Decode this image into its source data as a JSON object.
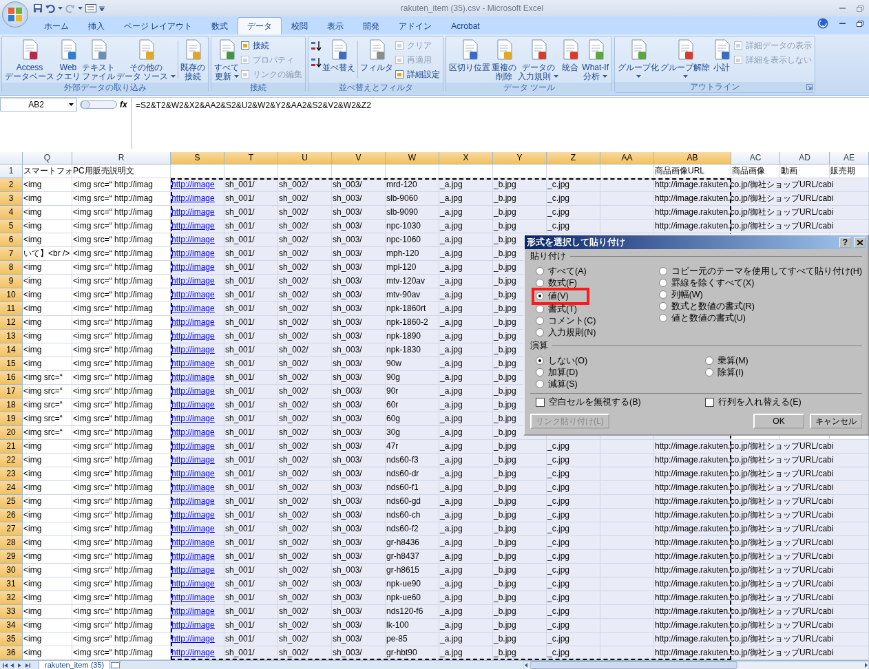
{
  "window": {
    "title": "rakuten_item (35).csv - Microsoft Excel"
  },
  "tabs": [
    {
      "label": "ホーム",
      "selected": false
    },
    {
      "label": "挿入",
      "selected": false
    },
    {
      "label": "ページ レイアウト",
      "selected": false
    },
    {
      "label": "数式",
      "selected": false
    },
    {
      "label": "データ",
      "selected": true
    },
    {
      "label": "校閲",
      "selected": false
    },
    {
      "label": "表示",
      "selected": false
    },
    {
      "label": "開発",
      "selected": false
    },
    {
      "label": "アドイン",
      "selected": false
    },
    {
      "label": "Acrobat",
      "selected": false
    }
  ],
  "ribbon": {
    "groups": [
      {
        "label": "外部データの取り込み",
        "launcher": false,
        "items": [
          {
            "kind": "large",
            "lines": [
              "Access",
              "データベース"
            ],
            "dropdown": false
          },
          {
            "kind": "large",
            "lines": [
              "Web",
              "クエリ"
            ],
            "dropdown": false
          },
          {
            "kind": "large",
            "lines": [
              "テキスト",
              "ファイル"
            ],
            "dropdown": false
          },
          {
            "kind": "large",
            "lines": [
              "その他の",
              "データ ソース"
            ],
            "dropdown": true
          },
          {
            "kind": "separator"
          },
          {
            "kind": "large",
            "lines": [
              "既存の",
              "接続"
            ],
            "dropdown": false
          }
        ]
      },
      {
        "label": "接続",
        "launcher": false,
        "items": [
          {
            "kind": "large",
            "lines": [
              "すべて",
              "更新"
            ],
            "dropdown": true
          },
          {
            "kind": "stack",
            "items": [
              {
                "label": "接続",
                "disabled": false
              },
              {
                "label": "プロパティ",
                "disabled": true
              },
              {
                "label": "リンクの編集",
                "disabled": true
              }
            ]
          }
        ]
      },
      {
        "label": "並べ替えとフィルタ",
        "launcher": false,
        "items": [
          {
            "kind": "stack",
            "items": [
              {
                "disabled": false
              },
              {
                "disabled": false
              }
            ]
          },
          {
            "kind": "large",
            "lines": [
              "並べ替え"
            ],
            "dropdown": false
          },
          {
            "kind": "separator"
          },
          {
            "kind": "large",
            "lines": [
              "フィルタ"
            ],
            "dropdown": false
          },
          {
            "kind": "stack",
            "items": [
              {
                "label": "クリア",
                "disabled": true
              },
              {
                "label": "再適用",
                "disabled": true
              },
              {
                "label": "詳細設定",
                "disabled": false
              }
            ]
          }
        ]
      },
      {
        "label": "データ ツール",
        "launcher": false,
        "items": [
          {
            "kind": "large",
            "lines": [
              "区切り位置"
            ],
            "dropdown": false
          },
          {
            "kind": "large",
            "lines": [
              "重複の",
              "削除"
            ],
            "dropdown": false
          },
          {
            "kind": "large",
            "lines": [
              "データの",
              "入力規則"
            ],
            "dropdown": true
          },
          {
            "kind": "large",
            "lines": [
              "統合"
            ],
            "dropdown": false
          },
          {
            "kind": "large",
            "lines": [
              "What-If",
              "分析"
            ],
            "dropdown": true
          }
        ]
      },
      {
        "label": "アウトライン",
        "launcher": true,
        "items": [
          {
            "kind": "large",
            "lines": [
              "グループ化"
            ],
            "dropdown": true
          },
          {
            "kind": "large",
            "lines": [
              "グループ解除"
            ],
            "dropdown": true
          },
          {
            "kind": "large",
            "lines": [
              "小計"
            ],
            "dropdown": false
          },
          {
            "kind": "stack",
            "items": [
              {
                "label": "詳細データの表示",
                "disabled": true
              },
              {
                "label": "詳細を表示しない",
                "disabled": true
              }
            ]
          }
        ]
      }
    ]
  },
  "formula_bar": {
    "name_box": "AB2",
    "fx_label": "fx",
    "formula": "=S2&T2&W2&X2&AA2&S2&U2&W2&Y2&AA2&S2&V2&W2&Z2"
  },
  "columns": [
    {
      "label": "Q",
      "selected": false,
      "kind": "text"
    },
    {
      "label": "R",
      "selected": false,
      "kind": "text"
    },
    {
      "label": "S",
      "selected": true,
      "kind": "link"
    },
    {
      "label": "T",
      "selected": true,
      "kind": "text"
    },
    {
      "label": "U",
      "selected": true,
      "kind": "text"
    },
    {
      "label": "V",
      "selected": true,
      "kind": "text"
    },
    {
      "label": "W",
      "selected": true,
      "kind": "text"
    },
    {
      "label": "X",
      "selected": true,
      "kind": "text"
    },
    {
      "label": "Y",
      "selected": true,
      "kind": "text"
    },
    {
      "label": "Z",
      "selected": true,
      "kind": "text"
    },
    {
      "label": "AA",
      "selected": true
    },
    {
      "label": "AB",
      "selected": true,
      "kind": "text"
    },
    {
      "label": "AC",
      "selected": false,
      "kind": "text"
    },
    {
      "label": "AD",
      "selected": false,
      "kind": "text"
    },
    {
      "label": "AE",
      "selected": false,
      "kind": "text"
    }
  ],
  "rows": [
    {
      "number": "1",
      "selected": false,
      "cells": [
        "スマートフォ",
        "PC用販売説明文",
        null,
        null,
        null,
        null,
        null,
        null,
        null,
        null,
        null,
        "商品画像URL",
        "商品画像",
        "動画",
        "販売期"
      ]
    },
    {
      "number": "2",
      "selected": true,
      "cells": [
        "<img",
        "<img src=“ http://imag",
        "http://image",
        "sh_001/",
        "sh_002/",
        "sh_003/",
        "mrd-120",
        "_a.jpg",
        "_b.jpg",
        "_c.jpg",
        null,
        "http://image.rakuten.co.jp/御社ショップURL/cabi"
      ]
    },
    {
      "number": "3",
      "selected": true,
      "cells": [
        "<img",
        "<img src=“ http://imag",
        "http://image",
        "sh_001/",
        "sh_002/",
        "sh_003/",
        "slb-9060",
        "_a.jpg",
        "_b.jpg",
        "_c.jpg",
        null,
        "http://image.rakuten.co.jp/御社ショップURL/cabi"
      ]
    },
    {
      "number": "4",
      "selected": true,
      "cells": [
        "<img",
        "<img src=“ http://imag",
        "http://image",
        "sh_001/",
        "sh_002/",
        "sh_003/",
        "slb-9090",
        "_a.jpg",
        "_b.jpg",
        "_c.jpg",
        null,
        "http://image.rakuten.co.jp/御社ショップURL/cabi"
      ]
    },
    {
      "number": "5",
      "selected": true,
      "cells": [
        "<img",
        "<img src=“ http://imag",
        "http://image",
        "sh_001/",
        "sh_002/",
        "sh_003/",
        "npc-1030",
        "_a.jpg",
        "_b.jpg",
        "_c.jpg",
        null,
        "http://image.rakuten.co.jp/御社ショップURL/cabi"
      ]
    },
    {
      "number": "6",
      "selected": true,
      "cells": [
        "<img",
        "<img src=“ http://imag",
        "http://image",
        "sh_001/",
        "sh_002/",
        "sh_003/",
        "npc-1060",
        "_a.jpg",
        "_b.jpg"
      ]
    },
    {
      "number": "7",
      "selected": true,
      "cells": [
        "いて】<br />",
        "<img src=“ http://imag",
        "http://image",
        "sh_001/",
        "sh_002/",
        "sh_003/",
        "mph-120",
        "_a.jpg",
        "_b.jpg"
      ]
    },
    {
      "number": "8",
      "selected": true,
      "cells": [
        "<img",
        "<img src=“ http://imag",
        "http://image",
        "sh_001/",
        "sh_002/",
        "sh_003/",
        "mpl-120",
        "_a.jpg",
        "_b.jpg"
      ]
    },
    {
      "number": "9",
      "selected": true,
      "cells": [
        "<img",
        "<img src=“ http://imag",
        "http://image",
        "sh_001/",
        "sh_002/",
        "sh_003/",
        "mtv-120av",
        "_a.jpg",
        "_b.jpg"
      ]
    },
    {
      "number": "10",
      "selected": true,
      "cells": [
        "<img",
        "<img src=“ http://imag",
        "http://image",
        "sh_001/",
        "sh_002/",
        "sh_003/",
        "mtv-90av",
        "_a.jpg",
        "_b.jpg"
      ]
    },
    {
      "number": "11",
      "selected": true,
      "cells": [
        "<img",
        "<img src=“ http://imag",
        "http://image",
        "sh_001/",
        "sh_002/",
        "sh_003/",
        "npk-1860rt",
        "_a.jpg",
        "_b.jpg"
      ]
    },
    {
      "number": "12",
      "selected": true,
      "cells": [
        "<img",
        "<img src=“ http://imag",
        "http://image",
        "sh_001/",
        "sh_002/",
        "sh_003/",
        "npk-1860-2",
        "_a.jpg",
        "_b.jpg"
      ]
    },
    {
      "number": "13",
      "selected": true,
      "cells": [
        "<img",
        "<img src=“ http://imag",
        "http://image",
        "sh_001/",
        "sh_002/",
        "sh_003/",
        "npk-1890",
        "_a.jpg",
        "_b.jpg"
      ]
    },
    {
      "number": "14",
      "selected": true,
      "cells": [
        "<img",
        "<img src=“ http://imag",
        "http://image",
        "sh_001/",
        "sh_002/",
        "sh_003/",
        "npk-1830",
        "_a.jpg",
        "_b.jpg"
      ]
    },
    {
      "number": "15",
      "selected": true,
      "cells": [
        "<img",
        "<img src=“ http://imag",
        "http://image",
        "sh_001/",
        "sh_002/",
        "sh_003/",
        "90w",
        "_a.jpg",
        "_b.jpg"
      ]
    },
    {
      "number": "16",
      "selected": true,
      "cells": [
        "<img src=“",
        "<img src=“ http://imag",
        "http://image",
        "sh_001/",
        "sh_002/",
        "sh_003/",
        "90g",
        "_a.jpg",
        "_b.jpg"
      ]
    },
    {
      "number": "17",
      "selected": true,
      "cells": [
        "<img src=“",
        "<img src=“ http://imag",
        "http://image",
        "sh_001/",
        "sh_002/",
        "sh_003/",
        "90r",
        "_a.jpg",
        "_b.jpg"
      ]
    },
    {
      "number": "18",
      "selected": true,
      "cells": [
        "<img src=“",
        "<img src=“ http://imag",
        "http://image",
        "sh_001/",
        "sh_002/",
        "sh_003/",
        "60r",
        "_a.jpg",
        "_b.jpg"
      ]
    },
    {
      "number": "19",
      "selected": true,
      "cells": [
        "<img src=“",
        "<img src=“ http://imag",
        "http://image",
        "sh_001/",
        "sh_002/",
        "sh_003/",
        "60g",
        "_a.jpg",
        "_b.jpg"
      ]
    },
    {
      "number": "20",
      "selected": true,
      "cells": [
        "<img src=“",
        "<img src=“ http://imag",
        "http://image",
        "sh_001/",
        "sh_002/",
        "sh_003/",
        "30g",
        "_a.jpg",
        "_b.jpg"
      ]
    },
    {
      "number": "21",
      "selected": true,
      "cells": [
        "<img",
        "<img src=“ http://imag",
        "http://image",
        "sh_001/",
        "sh_002/",
        "sh_003/",
        "47r",
        "_a.jpg",
        "_b.jpg",
        "_c.jpg",
        null,
        "http://image.rakuten.co.jp/御社ショップURL/cabi"
      ]
    },
    {
      "number": "22",
      "selected": true,
      "cells": [
        "<img",
        "<img src=“ http://imag",
        "http://image",
        "sh_001/",
        "sh_002/",
        "sh_003/",
        "nds60-f3",
        "_a.jpg",
        "_b.jpg",
        "_c.jpg",
        null,
        "http://image.rakuten.co.jp/御社ショップURL/cabi"
      ]
    },
    {
      "number": "23",
      "selected": true,
      "cells": [
        "<img",
        "<img src=“ http://imag",
        "http://image",
        "sh_001/",
        "sh_002/",
        "sh_003/",
        "nds60-dr",
        "_a.jpg",
        "_b.jpg",
        "_c.jpg",
        null,
        "http://image.rakuten.co.jp/御社ショップURL/cabi"
      ]
    },
    {
      "number": "24",
      "selected": true,
      "cells": [
        "<img",
        "<img src=“ http://imag",
        "http://image",
        "sh_001/",
        "sh_002/",
        "sh_003/",
        "nds60-f1",
        "_a.jpg",
        "_b.jpg",
        "_c.jpg",
        null,
        "http://image.rakuten.co.jp/御社ショップURL/cabi"
      ]
    },
    {
      "number": "25",
      "selected": true,
      "cells": [
        "<img",
        "<img src=“ http://imag",
        "http://image",
        "sh_001/",
        "sh_002/",
        "sh_003/",
        "nds60-gd",
        "_a.jpg",
        "_b.jpg",
        "_c.jpg",
        null,
        "http://image.rakuten.co.jp/御社ショップURL/cabi"
      ]
    },
    {
      "number": "26",
      "selected": true,
      "cells": [
        "<img",
        "<img src=“ http://imag",
        "http://image",
        "sh_001/",
        "sh_002/",
        "sh_003/",
        "nds60-ch",
        "_a.jpg",
        "_b.jpg",
        "_c.jpg",
        null,
        "http://image.rakuten.co.jp/御社ショップURL/cabi"
      ]
    },
    {
      "number": "27",
      "selected": true,
      "cells": [
        "<img",
        "<img src=“ http://imag",
        "http://image",
        "sh_001/",
        "sh_002/",
        "sh_003/",
        "nds60-f2",
        "_a.jpg",
        "_b.jpg",
        "_c.jpg",
        null,
        "http://image.rakuten.co.jp/御社ショップURL/cabi"
      ]
    },
    {
      "number": "28",
      "selected": true,
      "cells": [
        "<img",
        "<img src=“ http://imag",
        "http://image",
        "sh_001/",
        "sh_002/",
        "sh_003/",
        "gr-h8436",
        "_a.jpg",
        "_b.jpg",
        "_c.jpg",
        null,
        "http://image.rakuten.co.jp/御社ショップURL/cabi"
      ]
    },
    {
      "number": "29",
      "selected": true,
      "cells": [
        "<img",
        "<img src=“ http://imag",
        "http://image",
        "sh_001/",
        "sh_002/",
        "sh_003/",
        "gr-h8437",
        "_a.jpg",
        "_b.jpg",
        "_c.jpg",
        null,
        "http://image.rakuten.co.jp/御社ショップURL/cabi"
      ]
    },
    {
      "number": "30",
      "selected": true,
      "cells": [
        "<img",
        "<img src=“ http://imag",
        "http://image",
        "sh_001/",
        "sh_002/",
        "sh_003/",
        "gr-h8615",
        "_a.jpg",
        "_b.jpg",
        "_c.jpg",
        null,
        "http://image.rakuten.co.jp/御社ショップURL/cabi"
      ]
    },
    {
      "number": "31",
      "selected": true,
      "cells": [
        "<img",
        "<img src=“ http://imag",
        "http://image",
        "sh_001/",
        "sh_002/",
        "sh_003/",
        "npk-ue90",
        "_a.jpg",
        "_b.jpg",
        "_c.jpg",
        null,
        "http://image.rakuten.co.jp/御社ショップURL/cabi"
      ]
    },
    {
      "number": "32",
      "selected": true,
      "cells": [
        "<img",
        "<img src=“ http://imag",
        "http://image",
        "sh_001/",
        "sh_002/",
        "sh_003/",
        "npk-ue60",
        "_a.jpg",
        "_b.jpg",
        "_c.jpg",
        null,
        "http://image.rakuten.co.jp/御社ショップURL/cabi"
      ]
    },
    {
      "number": "33",
      "selected": true,
      "cells": [
        "<img",
        "<img src=“ http://imag",
        "http://image",
        "sh_001/",
        "sh_002/",
        "sh_003/",
        "nds120-f6",
        "_a.jpg",
        "_b.jpg",
        "_c.jpg",
        null,
        "http://image.rakuten.co.jp/御社ショップURL/cabi"
      ]
    },
    {
      "number": "34",
      "selected": true,
      "cells": [
        "<img",
        "<img src=“ http://imag",
        "http://image",
        "sh_001/",
        "sh_002/",
        "sh_003/",
        "lk-100",
        "_a.jpg",
        "_b.jpg",
        "_c.jpg",
        null,
        "http://image.rakuten.co.jp/御社ショップURL/cabi"
      ]
    },
    {
      "number": "35",
      "selected": true,
      "cells": [
        "<img",
        "<img src=“ http://imag",
        "http://image",
        "sh_001/",
        "sh_002/",
        "sh_003/",
        "pe-85",
        "_a.jpg",
        "_b.jpg",
        "_c.jpg",
        null,
        "http://image.rakuten.co.jp/御社ショップURL/cabi"
      ]
    },
    {
      "number": "36",
      "selected": true,
      "cells": [
        "<img",
        "<img src=“ http://imag",
        "http://image",
        "sh_001/",
        "sh_002/",
        "sh_003/",
        "gr-hbt90",
        "_a.jpg",
        "_b.jpg",
        "_c.jpg",
        null,
        "http://image.rakuten.co.jp/御社ショップURL/cabi"
      ]
    }
  ],
  "sheet_tabs": [
    {
      "label": "rakuten_item (35)",
      "selected": true
    }
  ],
  "dialog": {
    "title": "形式を選択して貼り付け",
    "help_label": "?",
    "sections": [
      {
        "label": "貼り付け",
        "columns": [
          [
            {
              "label": "すべて(A)",
              "selected": false,
              "highlighted": false
            },
            {
              "label": "数式(F)",
              "selected": false,
              "highlighted": false
            },
            {
              "label": "値(V)",
              "selected": true,
              "highlighted": true
            },
            {
              "label": "書式(T)",
              "selected": false,
              "highlighted": false
            },
            {
              "label": "コメント(C)",
              "selected": false,
              "highlighted": false
            },
            {
              "label": "入力規則(N)",
              "selected": false,
              "highlighted": false
            }
          ],
          [
            {
              "label": "コピー元のテーマを使用してすべて貼り付け(H)",
              "selected": false,
              "highlighted": false
            },
            {
              "label": "罫線を除くすべて(X)",
              "selected": false,
              "highlighted": false
            },
            {
              "label": "列幅(W)",
              "selected": false,
              "highlighted": false
            },
            {
              "label": "数式と数値の書式(R)",
              "selected": false,
              "highlighted": false
            },
            {
              "label": "値と数値の書式(U)",
              "selected": false,
              "highlighted": false
            }
          ]
        ]
      },
      {
        "label": "演算",
        "columns": [
          [
            {
              "label": "しない(O)",
              "selected": true,
              "highlighted": false
            },
            {
              "label": "加算(D)",
              "selected": false,
              "highlighted": false
            },
            {
              "label": "減算(S)",
              "selected": false,
              "highlighted": false
            }
          ],
          [
            {
              "label": "乗算(M)",
              "selected": false,
              "highlighted": false
            },
            {
              "label": "除算(I)",
              "selected": false,
              "highlighted": false
            }
          ]
        ]
      }
    ],
    "checkboxes": [
      {
        "label": "空白セルを無視する(B)",
        "checked": false
      },
      {
        "label": "行列を入れ替える(E)",
        "checked": false
      }
    ],
    "buttons": [
      {
        "label": "リンク貼り付け(L)",
        "disabled": true
      },
      {
        "label": "OK",
        "disabled": false
      },
      {
        "label": "キャンセル",
        "disabled": false
      }
    ]
  }
}
